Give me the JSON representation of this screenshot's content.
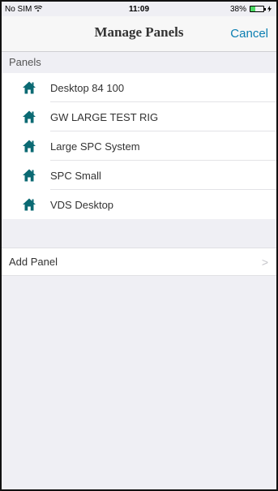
{
  "status_bar": {
    "carrier": "No SIM",
    "wifi_icon": "wifi-icon",
    "time": "11:09",
    "battery_percent": "38%",
    "battery_level": 0.38,
    "charging_icon": "bolt-icon"
  },
  "nav": {
    "title": "Manage Panels",
    "cancel_label": "Cancel"
  },
  "section": {
    "header": "Panels"
  },
  "panels": [
    {
      "label": "Desktop 84 100",
      "icon": "home-icon"
    },
    {
      "label": "GW LARGE TEST RIG",
      "icon": "home-icon"
    },
    {
      "label": "Large SPC System",
      "icon": "home-icon"
    },
    {
      "label": "SPC Small",
      "icon": "home-icon"
    },
    {
      "label": "VDS Desktop",
      "icon": "home-icon"
    }
  ],
  "add_panel": {
    "label": "Add Panel",
    "chevron": ">"
  },
  "colors": {
    "accent": "#0a7eb1",
    "icon": "#0b6a73",
    "background": "#efeff4"
  }
}
